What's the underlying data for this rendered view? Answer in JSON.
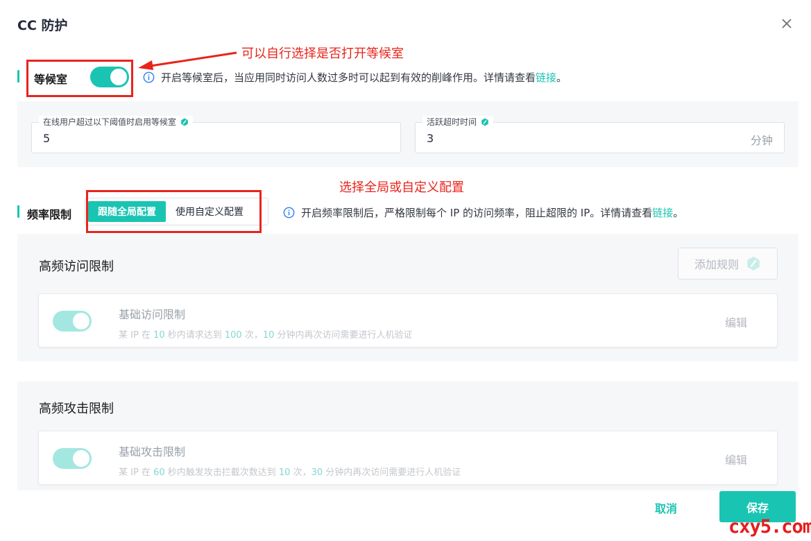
{
  "dialog": {
    "title": "CC 防护"
  },
  "waiting_room": {
    "label": "等候室",
    "enabled": true,
    "info_text": "开启等候室后，当应用同时访问人数过多时可以起到有效的削峰作用。详情请查看",
    "info_link": "链接",
    "info_suffix": "。",
    "threshold_label": "在线用户超过以下阈值时启用等候室",
    "threshold_value": "5",
    "timeout_label": "活跃超时时间",
    "timeout_value": "3",
    "timeout_unit": "分钟"
  },
  "rate_limit": {
    "label": "频率限制",
    "options": [
      "跟随全局配置",
      "使用自定义配置"
    ],
    "selected": "跟随全局配置",
    "info_text": "开启频率限制后，严格限制每个 IP 的访问频率，阻止超限的 IP。详情请查看",
    "info_link": "链接",
    "info_suffix": "。"
  },
  "high_freq_access": {
    "title": "高频访问限制",
    "add_rule": "添加规则",
    "rule": {
      "name": "基础访问限制",
      "enabled": true,
      "desc_1": "某 IP 在 ",
      "n1": "10",
      "desc_2": " 秒内请求达到 ",
      "n2": "100",
      "desc_3": " 次，",
      "n3": "10",
      "desc_4": " 分钟内再次访问需要进行人机验证",
      "edit": "编辑"
    }
  },
  "high_freq_attack": {
    "title": "高频攻击限制",
    "rule": {
      "name": "基础攻击限制",
      "enabled": true,
      "desc_1": "某 IP 在 ",
      "n1": "60",
      "desc_2": " 秒内触发攻击拦截次数达到 ",
      "n2": "10",
      "desc_3": " 次，",
      "n3": "30",
      "desc_4": " 分钟内再次访问需要进行人机验证",
      "edit": "编辑"
    }
  },
  "footer": {
    "cancel": "取消",
    "save": "保存"
  },
  "annotations": {
    "note_1": "可以自行选择是否打开等候室",
    "note_2": "选择全局或自定义配置",
    "color": "#e8241b"
  },
  "watermark": "cxy5.com",
  "colors": {
    "accent": "#1ac4b2",
    "accent_dim": "#a4e7e0"
  }
}
